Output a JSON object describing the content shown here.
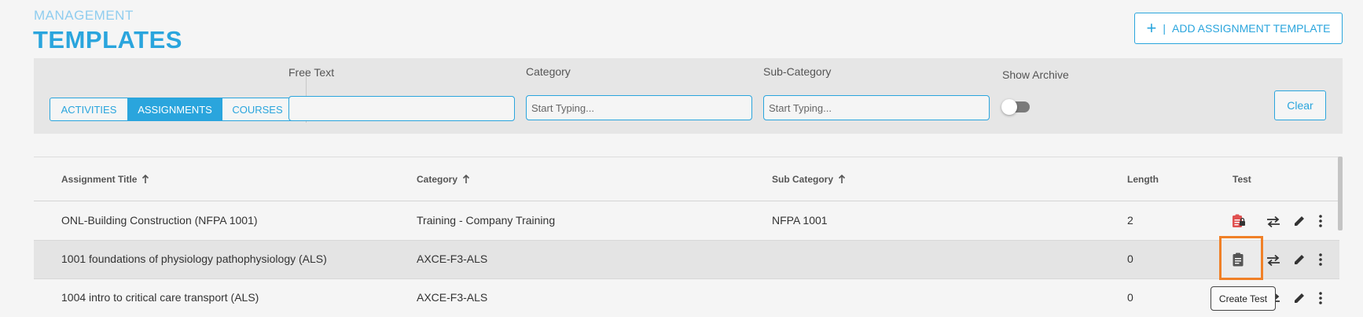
{
  "header": {
    "eyebrow": "MANAGEMENT",
    "title": "TEMPLATES",
    "add_button": {
      "plus": "+",
      "separator": "|",
      "label": "ADD ASSIGNMENT TEMPLATE"
    }
  },
  "filters": {
    "tabs": [
      {
        "label": "ACTIVITIES",
        "active": false
      },
      {
        "label": "ASSIGNMENTS",
        "active": true
      },
      {
        "label": "COURSES",
        "active": false
      }
    ],
    "free_text": {
      "label": "Free Text",
      "value": "",
      "placeholder": ""
    },
    "category": {
      "label": "Category",
      "value": "",
      "placeholder": "Start Typing..."
    },
    "sub_category": {
      "label": "Sub-Category",
      "value": "",
      "placeholder": "Start Typing..."
    },
    "show_archive": {
      "label": "Show Archive",
      "on": false
    },
    "clear_label": "Clear"
  },
  "table": {
    "columns": {
      "title": "Assignment Title",
      "category": "Category",
      "sub_category": "Sub Category",
      "length": "Length",
      "test": "Test"
    },
    "rows": [
      {
        "title": "ONL-Building Construction (NFPA 1001)",
        "category": "Training - Company Training",
        "sub_category": "NFPA 1001",
        "length": "2",
        "test_icon": "locked-test-icon"
      },
      {
        "title": "1001 foundations of physiology pathophysiology (ALS)",
        "category": "AXCE-F3-ALS",
        "sub_category": "",
        "length": "0",
        "test_icon": "create-test-icon"
      },
      {
        "title": "1004 intro to critical care transport (ALS)",
        "category": "AXCE-F3-ALS",
        "sub_category": "",
        "length": "0",
        "test_icon": "create-test-icon"
      }
    ],
    "tooltip": "Create Test"
  },
  "colors": {
    "accent": "#2aa5dd",
    "highlight": "#f08027",
    "locked_test": "#e05050"
  }
}
